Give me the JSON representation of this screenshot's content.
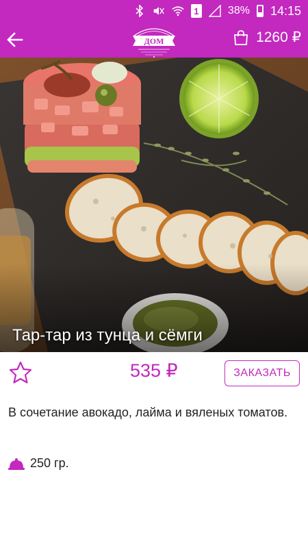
{
  "status_bar": {
    "battery_percent": "38%",
    "sim_slot": "1",
    "time": "14:15",
    "icons": [
      "bluetooth-icon",
      "mute-icon",
      "wifi-icon",
      "sim-icon",
      "signal-icon",
      "battery-icon"
    ]
  },
  "app_bar": {
    "back_icon": "arrow-left-icon",
    "logo_text": "ДОМ",
    "cart_icon": "shopping-bag-icon",
    "cart_total": "1260 ₽",
    "background_color": "#c328bf"
  },
  "product": {
    "title": "Тар-тар из тунца и сёмги",
    "price": "535 ₽",
    "order_label": "ЗАКАЗАТЬ",
    "favorite_icon": "star-outline-icon",
    "description": "В сочетание авокадо, лайма и вяленых томатов.",
    "weight_icon": "cloche-icon",
    "weight": "250 гр."
  },
  "colors": {
    "accent": "#c328bf",
    "text": "#222222"
  }
}
